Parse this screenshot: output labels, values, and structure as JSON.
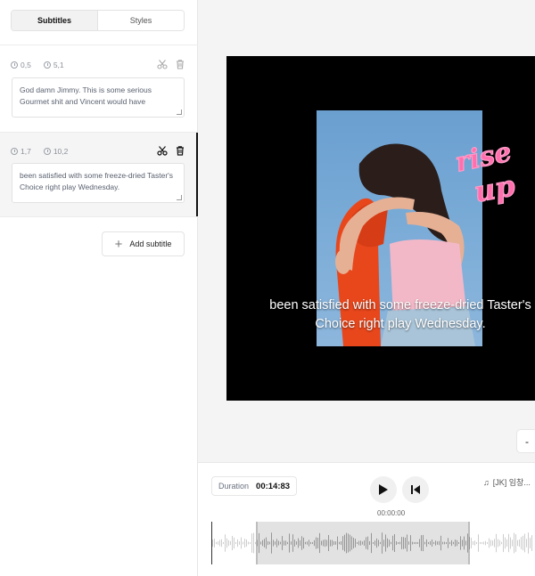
{
  "tabs": [
    {
      "label": "Subtitles",
      "active": true
    },
    {
      "label": "Styles",
      "active": false
    }
  ],
  "subtitles": [
    {
      "start": "0,5",
      "end": "5,1",
      "text": "God damn Jimmy. This is some serious Gourmet shit and Vincent would have"
    },
    {
      "start": "1,7",
      "end": "10,2",
      "text": "been satisfied with some freeze-dried Taster's Choice right play Wednesday."
    }
  ],
  "add_subtitle_label": "Add subtitle",
  "preview": {
    "caption": "been satisfied with some freeze-dried Taster's Choice right play Wednesday.",
    "sticker_text": "rise up"
  },
  "side_chip": "-",
  "player": {
    "duration_label": "Duration",
    "duration_value": "00:14:83",
    "current_time": "00:00:00",
    "track": "[JK] 임창..."
  },
  "colors": {
    "accent": "#111111",
    "sticker": "#ff6fae",
    "orange_jacket": "#e8471c",
    "pink_top": "#f3b8c8"
  }
}
